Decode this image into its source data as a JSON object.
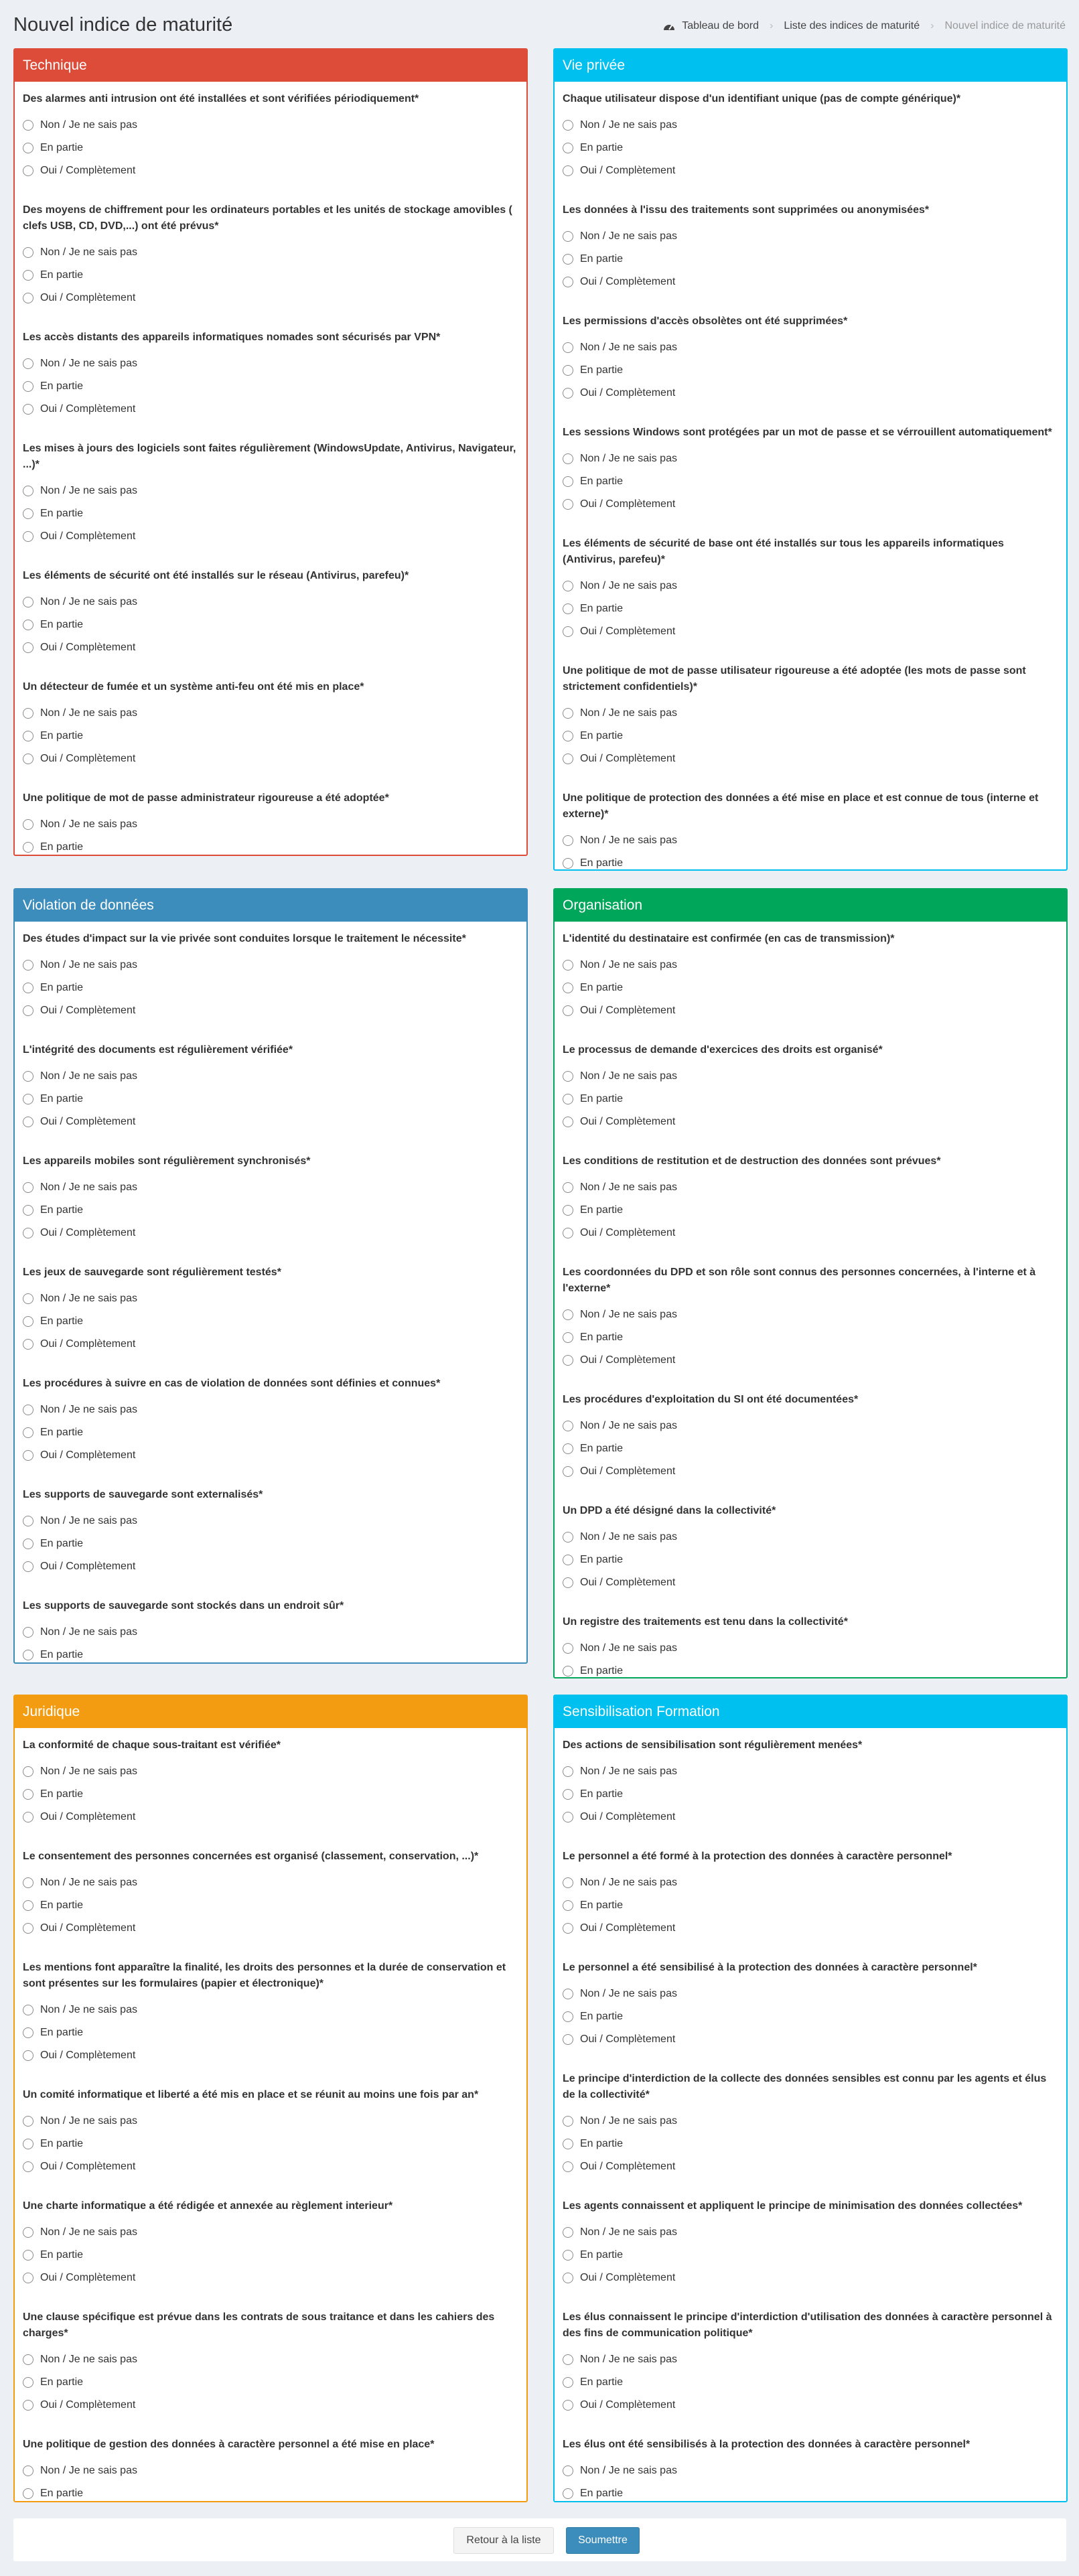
{
  "page": {
    "title": "Nouvel indice de maturité",
    "breadcrumb": [
      "Tableau de bord",
      "Liste des indices de maturité",
      "Nouvel indice de maturité"
    ]
  },
  "options": [
    "Non / Je ne sais pas",
    "En partie",
    "Oui / Complètement"
  ],
  "sections": [
    {
      "title": "Technique",
      "color": "#dd4b39",
      "questions": [
        "Des alarmes anti intrusion ont été installées et sont vérifiées périodiquement*",
        "Des moyens de chiffrement pour les ordinateurs portables et les unités de stockage amovibles ( clefs USB, CD, DVD,...) ont été prévus*",
        "Les accès distants des appareils informatiques nomades sont sécurisés par VPN*",
        "Les mises à jours des logiciels sont faites régulièrement (WindowsUpdate, Antivirus, Navigateur, ...)*",
        "Les éléments de sécurité ont été installés sur le réseau (Antivirus, parefeu)*",
        "Un détecteur de fumée et un système anti-feu ont été mis en place*",
        "Une politique de mot de passe administrateur rigoureuse a été adoptée*"
      ]
    },
    {
      "title": "Vie privée",
      "color": "#00c0ef",
      "questions": [
        "Chaque utilisateur dispose d'un identifiant unique (pas de compte générique)*",
        "Les données à l'issu des traitements sont supprimées ou anonymisées*",
        "Les permissions d'accès obsolètes ont été supprimées*",
        "Les sessions Windows sont protégées par un mot de passe et se vérrouillent automatiquement*",
        "Les éléments de sécurité de base ont été installés sur tous les appareils informatiques (Antivirus, parefeu)*",
        "Une politique de mot de passe utilisateur rigoureuse a été adoptée (les mots de passe sont strictement confidentiels)*",
        "Une politique de protection des données a été mise en place et est connue de tous (interne et externe)*"
      ]
    },
    {
      "title": "Violation de données",
      "color": "#3c8dbc",
      "questions": [
        "Des études d'impact sur la vie privée sont conduites lorsque le traitement le nécessite*",
        "L'intégrité des documents est régulièrement vérifiée*",
        "Les appareils mobiles sont régulièrement synchronisés*",
        "Les jeux de sauvegarde sont régulièrement testés*",
        "Les procédures à suivre en cas de violation de données sont définies et connues*",
        "Les supports de sauvegarde sont externalisés*",
        "Les supports de sauvegarde sont stockés dans un endroit sûr*"
      ]
    },
    {
      "title": "Organisation",
      "color": "#00a65a",
      "questions": [
        "L'identité du destinataire est confirmée (en cas de transmission)*",
        "Le processus de demande d'exercices des droits est organisé*",
        "Les conditions de restitution et de destruction des données sont prévues*",
        "Les coordonnées du DPD et son rôle sont connus des personnes concernées, à l'interne et à l'externe*",
        "Les procédures d'exploitation du SI ont été documentées*",
        "Un DPD a été désigné dans la collectivité*",
        "Un registre des traitements est tenu dans la collectivité*"
      ]
    },
    {
      "title": "Juridique",
      "color": "#f39c12",
      "questions": [
        "La conformité de chaque sous-traitant est vérifiée*",
        "Le consentement des personnes concernées est organisé (classement, conservation, ...)*",
        "Les mentions font apparaître la finalité, les droits des personnes et la durée de conservation et sont présentes sur les formulaires (papier et électronique)*",
        "Un comité informatique et liberté a été mis en place et se réunit au moins une fois par an*",
        "Une charte informatique a été rédigée et annexée au règlement interieur*",
        "Une clause spécifique est prévue dans les contrats de sous traitance et dans les cahiers des charges*",
        "Une politique de gestion des données à caractère personnel a été mise en place*"
      ]
    },
    {
      "title": "Sensibilisation Formation",
      "color": "#00c0ef",
      "questions": [
        "Des actions de sensibilisation sont régulièrement menées*",
        "Le personnel a été formé à la protection des données à caractère personnel*",
        "Le personnel a été sensibilisé à la protection des données à caractère personnel*",
        "Le principe d'interdiction de la collecte des données sensibles est connu par les agents et élus de la collectivité*",
        "Les agents connaissent et appliquent le principe de minimisation des données collectées*",
        "Les élus connaissent le principe d'interdiction d'utilisation des données à caractère personnel à des fins de communication politique*",
        "Les élus ont été sensibilisés à la protection des données à caractère personnel*"
      ]
    }
  ],
  "buttons": {
    "back": "Retour à la liste",
    "submit": "Soumettre"
  }
}
